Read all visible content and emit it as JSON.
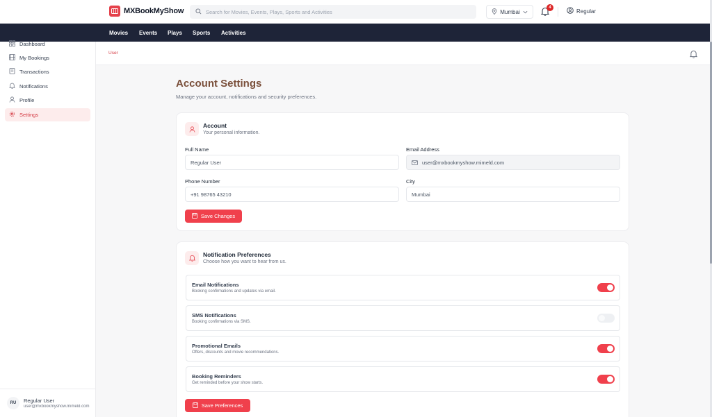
{
  "header": {
    "brand": "MXBookMyShow",
    "search_placeholder": "Search for Movies, Events, Plays, Sports and Activities",
    "city": "Mumbai",
    "notification_count": "4",
    "user_label": "Regular"
  },
  "nav": [
    "Movies",
    "Events",
    "Plays",
    "Sports",
    "Activities"
  ],
  "sidebar": {
    "items": [
      {
        "label": "Dashboard",
        "icon": "grid-icon"
      },
      {
        "label": "My Bookings",
        "icon": "film-icon"
      },
      {
        "label": "Transactions",
        "icon": "receipt-icon"
      },
      {
        "label": "Notifications",
        "icon": "bell-icon"
      },
      {
        "label": "Profile",
        "icon": "user-icon"
      },
      {
        "label": "Settings",
        "icon": "gear-icon",
        "active": true
      }
    ],
    "footer": {
      "initials": "RU",
      "name": "Regular User",
      "email": "user@mxbookmyshow.mimeld.com"
    }
  },
  "breadcrumb": "User",
  "page": {
    "title": "Account Settings",
    "subtitle": "Manage your account, notifications and security preferences."
  },
  "account": {
    "title": "Account",
    "subtitle": "Your personal information.",
    "full_name_label": "Full Name",
    "full_name_value": "Regular User",
    "email_label": "Email Address",
    "email_value": "user@mxbookmyshow.mimeld.com",
    "phone_label": "Phone Number",
    "phone_value": "+91 98765 43210",
    "city_label": "City",
    "city_value": "Mumbai",
    "save_label": "Save Changes"
  },
  "notifications": {
    "title": "Notification Preferences",
    "subtitle": "Choose how you want to hear from us.",
    "items": [
      {
        "title": "Email Notifications",
        "desc": "Booking confirmations and updates via email.",
        "enabled": true
      },
      {
        "title": "SMS Notifications",
        "desc": "Booking confirmations via SMS.",
        "enabled": false
      },
      {
        "title": "Promotional Emails",
        "desc": "Offers, discounts and movie recommendations.",
        "enabled": true
      },
      {
        "title": "Booking Reminders",
        "desc": "Get reminded before your show starts.",
        "enabled": true
      }
    ],
    "save_label": "Save Preferences"
  },
  "colors": {
    "accent": "#f0404c",
    "nav_bg": "#1e2438",
    "title_brown": "#7a4f3a"
  }
}
